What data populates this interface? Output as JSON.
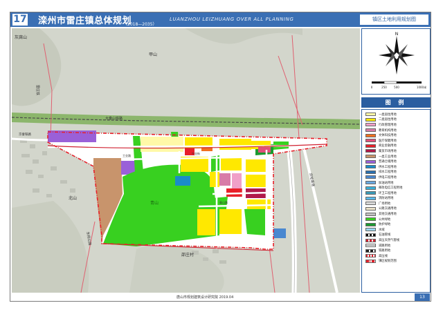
{
  "header": {
    "sheet_number": "17",
    "title": "滦州市雷庄镇总体规划",
    "years": "（2018—2035）",
    "english_title": "LUANZHOU LEIZHUANG OVER ALL PLANNING",
    "drawing_name": "镇区土地利用规划图"
  },
  "map_labels": {
    "railway_top": "大秦山铁路",
    "railway_left": "雷庄铁",
    "mountain_north": "甲山",
    "mountain_nw": "灰腐山",
    "park_hill": "青山",
    "mountain_south": "北山",
    "village_south": "邵庄村",
    "road_sw": "东杨公路",
    "road_east": "京哈高速",
    "road_west": "京秦铁路",
    "street_1": "兴业街",
    "street_2": "工业路",
    "street_3": "青山路"
  },
  "scale": {
    "ticks": [
      "0",
      "250",
      "500",
      "1000米"
    ]
  },
  "legend": {
    "title": "图  例",
    "items": [
      {
        "label": "一类居住用地",
        "color": "#fff9a8"
      },
      {
        "label": "二类居住用地",
        "color": "#ffe800"
      },
      {
        "label": "行政管理用地",
        "color": "#f0a0c8"
      },
      {
        "label": "教育机构用地",
        "color": "#d87ca8"
      },
      {
        "label": "文体科技用地",
        "color": "#f07020"
      },
      {
        "label": "医疗保健用地",
        "color": "#e0507a"
      },
      {
        "label": "商业金融用地",
        "color": "#e8202a"
      },
      {
        "label": "集贸市场用地",
        "color": "#b01a4a"
      },
      {
        "label": "一类工业用地",
        "color": "#c8946c"
      },
      {
        "label": "普通仓储用地",
        "color": "#9a60d8"
      },
      {
        "label": "供水工程用地",
        "color": "#1a8cc8"
      },
      {
        "label": "排水工程用地",
        "color": "#2a70b0"
      },
      {
        "label": "供电工程用地",
        "color": "#4a88d0"
      },
      {
        "label": "加油站用地",
        "color": "#6aa8e0"
      },
      {
        "label": "邮政电信工程用地",
        "color": "#3ab0d8"
      },
      {
        "label": "环卫工程用地",
        "color": "#3a9ab8"
      },
      {
        "label": "消防站用地",
        "color": "#5ab8e8"
      },
      {
        "label": "广场用地",
        "color": "#d8d8d8"
      },
      {
        "label": "公路交通用地",
        "color": "#e8e0c8"
      },
      {
        "label": "其他交通用地",
        "color": "#c0c0c0"
      },
      {
        "label": "公共绿地",
        "color": "#38d020"
      },
      {
        "label": "防护绿地",
        "color": "#1a9a30"
      },
      {
        "label": "水域",
        "color": "#9ad8f0"
      },
      {
        "label": "石油管线",
        "color": "#ffffff"
      },
      {
        "label": "高压天然气管线",
        "color": "#ffffff"
      },
      {
        "label": "道路用地",
        "color": "#ffffff"
      },
      {
        "label": "铁路用地",
        "color": "#ffffff"
      },
      {
        "label": "高压线",
        "color": "#ffffff"
      },
      {
        "label": "镇区规划范围",
        "color": "#ffffff"
      }
    ]
  },
  "footer": {
    "organization": "唐山市规划建筑设计研究院  2019.04",
    "page": "13"
  },
  "colors": {
    "header_blue": "#3a6fb4",
    "park_green": "#38d020",
    "residential_yellow": "#ffe800",
    "boundary_red": "#e8202a"
  }
}
